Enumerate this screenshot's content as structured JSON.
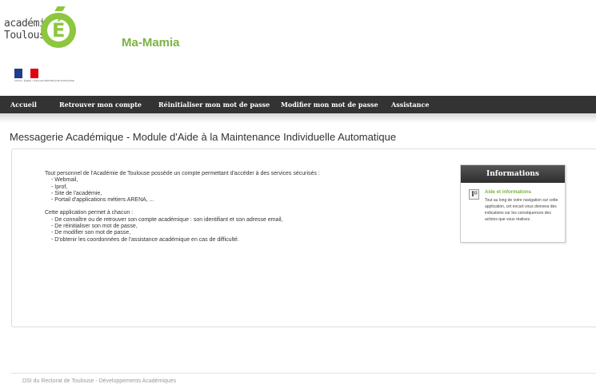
{
  "header": {
    "logo_text_line1": "académie",
    "logo_text_line2": "Toulouse",
    "logo_letter": "É",
    "app_title": "Ma-Mamia",
    "republic_caption": "Liberté • Égalité • Fraternité RÉPUBLIQUE FRANÇAISE"
  },
  "nav": {
    "items": [
      {
        "label": "Accueil"
      },
      {
        "label": "Retrouver mon compte"
      },
      {
        "label": "Réinitialiser mon mot de passe"
      },
      {
        "label": "Modifier mon mot de passe"
      },
      {
        "label": "Assistance"
      }
    ]
  },
  "main": {
    "page_title": "Messagerie Académique - Module d'Aide à la Maintenance Individuelle Automatique",
    "intro_lead": "Tout personnel de l'Académie de Toulouse possède un compte permettant d'accéder à des services sécurisés :",
    "services": [
      "- Webmail,",
      "- Iprof,",
      "- Site de l'académie,",
      "- Portail d'applications métiers ARENA, ..."
    ],
    "app_lead": "Cette application permet à chacun :",
    "features": [
      "- De connaître ou de retrouver son compte académique : son identifiant et son adresse email,",
      "- De réinitialiser son mot de passe,",
      "- De modifier son mot de passe,",
      "- D'obtenir les coordonnées de l'assistance académique en cas de difficulté."
    ]
  },
  "info_panel": {
    "title": "Informations",
    "icon": "info-figure-icon",
    "heading": "Aide et informations",
    "text": "Tout au long de votre navigation sur cette application, cet encart vous donnera des indications sur les conséquences des actions que vous réalisez."
  },
  "footer": {
    "text": "DSI du Rectorat de Toulouse - Développements Académiques"
  },
  "colors": {
    "brand_green": "#8dc63f",
    "navbar": "#333333",
    "link_green": "#7cb342"
  }
}
